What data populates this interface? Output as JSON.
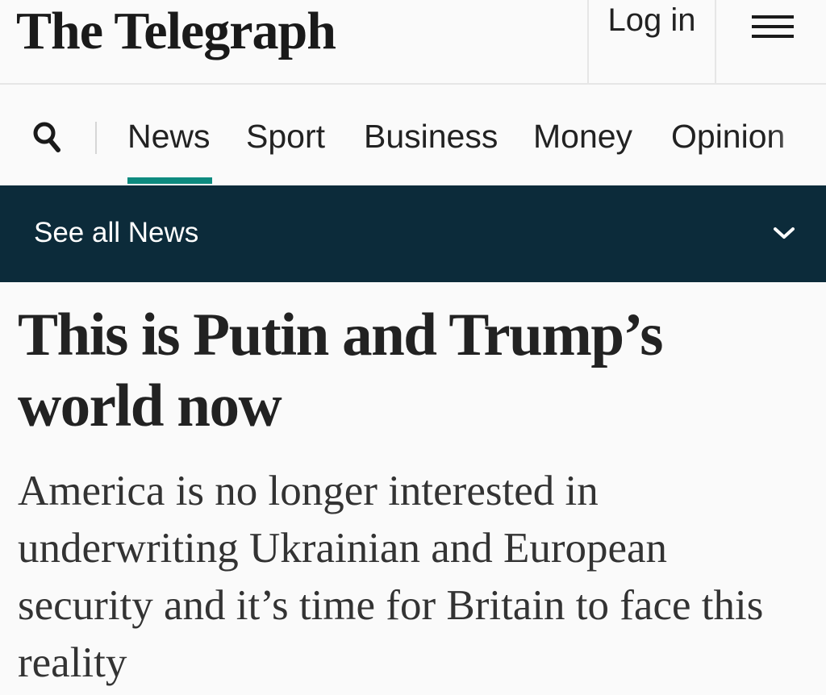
{
  "masthead": {
    "logo_text": "The Telegraph",
    "login_label": "Log in",
    "menu_icon": "hamburger-menu-icon"
  },
  "nav": {
    "search_icon": "search-icon",
    "items": [
      {
        "label": "News",
        "active": true
      },
      {
        "label": "Sport",
        "active": false
      },
      {
        "label": "Business",
        "active": false
      },
      {
        "label": "Money",
        "active": false
      },
      {
        "label": "Opinion",
        "active": false
      }
    ],
    "active_color": "#0d8a7f"
  },
  "subnav": {
    "label": "See all News",
    "chevron_icon": "chevron-down-icon",
    "background": "#0c2b3a"
  },
  "article": {
    "headline": "This is Putin and Trump’s world now",
    "standfirst": "America is no longer interested in underwriting Ukrainian and European security and it’s time for Britain to face this reality"
  }
}
